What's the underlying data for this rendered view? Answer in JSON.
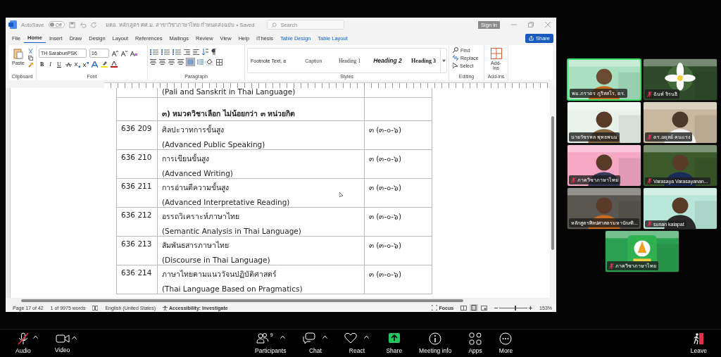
{
  "word": {
    "autosave_label": "AutoSave",
    "autosave": {
      "label": "Off",
      "on": false
    },
    "title": "มคอ. หลักสูตร ศศ.ม. สาขาวิชาภาษาไทย กำหนดส่งฉบับ • Saved",
    "search": {
      "placeholder": "Search"
    },
    "sign_in": "Sign in",
    "tabs": [
      {
        "label": "File",
        "selected": false,
        "kind": "normal"
      },
      {
        "label": "Home",
        "selected": true,
        "kind": "normal"
      },
      {
        "label": "Insert",
        "selected": false,
        "kind": "normal"
      },
      {
        "label": "Draw",
        "selected": false,
        "kind": "normal"
      },
      {
        "label": "Design",
        "selected": false,
        "kind": "normal"
      },
      {
        "label": "Layout",
        "selected": false,
        "kind": "normal"
      },
      {
        "label": "References",
        "selected": false,
        "kind": "normal"
      },
      {
        "label": "Mailings",
        "selected": false,
        "kind": "normal"
      },
      {
        "label": "Review",
        "selected": false,
        "kind": "normal"
      },
      {
        "label": "View",
        "selected": false,
        "kind": "normal"
      },
      {
        "label": "Help",
        "selected": false,
        "kind": "normal"
      },
      {
        "label": "iThesis",
        "selected": false,
        "kind": "normal"
      },
      {
        "label": "Table Design",
        "selected": false,
        "kind": "contextual"
      },
      {
        "label": "Table Layout",
        "selected": false,
        "kind": "contextual"
      }
    ],
    "share": "Share",
    "ribbon": {
      "clipboard": {
        "paste": "Paste",
        "label": "Clipboard"
      },
      "font": {
        "name": "TH SarabunPSK",
        "size": "16",
        "label": "Font",
        "bold": "B",
        "italic": "I",
        "underline": "U"
      },
      "paragraph": {
        "label": "Paragraph"
      },
      "styles": {
        "items": [
          "Footnote Text, ฮ",
          "Caption",
          "Heading 1",
          "Heading 2",
          "Heading 3"
        ],
        "label": "Styles"
      },
      "editing": {
        "find": "Find",
        "replace": "Replace",
        "select": "Select",
        "label": "Editing"
      },
      "addins": {
        "button": "Add-ins",
        "label": "Add-ins"
      }
    },
    "document": {
      "rows": [
        {
          "kind": "partial",
          "title": "(Pali and Sanskrit in Thai Language)"
        },
        {
          "kind": "heading",
          "title": "๓) หมวดวิชาเลือก ไม่น้อยกว่า ๓ หน่วยกิต"
        },
        {
          "kind": "course",
          "code": "636 209",
          "title": "ศิลปะวาทการขั้นสูง",
          "english": "(Advanced Public Speaking)",
          "credits": "๓ (๓-๐-๖)"
        },
        {
          "kind": "course",
          "code": "636 210",
          "title": "การเขียนขั้นสูง",
          "english": "(Advanced Writing)",
          "credits": "๓ (๓-๐-๖)"
        },
        {
          "kind": "course",
          "code": "636 211",
          "title": "การอ่านตีความขั้นสูง",
          "english": "(Advanced Interpretative Reading)",
          "credits": "๓ (๓-๐-๖)"
        },
        {
          "kind": "course",
          "code": "636 212",
          "title": "อรรถวิเคราะห์ภาษาไทย",
          "english": "(Semantic Analysis in Thai Language)",
          "credits": "๓ (๓-๐-๖)"
        },
        {
          "kind": "course",
          "code": "636 213",
          "title": "สัมพันธสารภาษาไทย",
          "english": "(Discourse in Thai Language)",
          "credits": "๓ (๓-๐-๖)"
        },
        {
          "kind": "course",
          "code": "636 214",
          "title": "ภาษาไทยตามแนววัจนปฏิบัติศาสตร์",
          "english": "(Thai Language Based on Pragmatics)",
          "credits": "๓ (๓-๐-๖)"
        }
      ]
    },
    "status": {
      "page": "Page 17 of 42",
      "words": "1 of 9975 words",
      "language": "English (United States)",
      "accessibility": "Accessibility: Investigate",
      "focus": "Focus",
      "zoom": "153%",
      "zoom_slider": {
        "level": 0.55
      }
    }
  },
  "gallery": [
    {
      "name": "พม.ภราดร ภูริสสโร, ดร.",
      "muted": false,
      "speaking": true
    },
    {
      "name": "ฉันท์ จิรนธิ",
      "muted": true,
      "speaking": false
    },
    {
      "name": "นายวัชรพล พุทธพนม",
      "muted": false,
      "speaking": false
    },
    {
      "name": "ดร.อดุลย์ คนแรง",
      "muted": true,
      "speaking": false
    },
    {
      "name": "ภาควิชาภาษาไทย",
      "muted": true,
      "speaking": false
    },
    {
      "name": "Varasaya Varasayanan...",
      "muted": true,
      "speaking": false
    },
    {
      "name": "หลักสูตรศิลปศาสตรมหาบัณฑิ...",
      "muted": false,
      "speaking": false
    },
    {
      "name": "sunan kalapat",
      "muted": true,
      "speaking": false
    },
    {
      "name": "ภาควิชาภาษาไทย",
      "muted": true,
      "speaking": false
    }
  ],
  "toolbar": {
    "left": [
      {
        "kind": "audio",
        "label": "Audio",
        "muted": true
      },
      {
        "kind": "video",
        "label": "Video",
        "muted": false
      }
    ],
    "center": [
      {
        "kind": "participants",
        "label": "Participants",
        "count": "9",
        "caret": true
      },
      {
        "kind": "chat",
        "label": "Chat",
        "caret": true
      },
      {
        "kind": "react",
        "label": "React",
        "caret": true
      },
      {
        "kind": "share",
        "label": "Share",
        "caret": false
      },
      {
        "kind": "info",
        "label": "Meeting info",
        "caret": false
      },
      {
        "kind": "apps",
        "label": "Apps",
        "caret": false
      },
      {
        "kind": "more",
        "label": "More",
        "caret": false
      }
    ],
    "leave": "Leave"
  }
}
